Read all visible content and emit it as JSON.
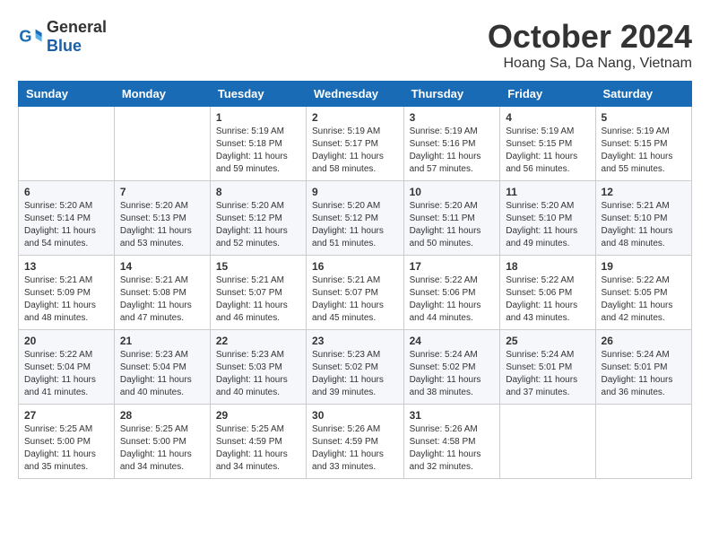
{
  "logo": {
    "general": "General",
    "blue": "Blue"
  },
  "title": "October 2024",
  "location": "Hoang Sa, Da Nang, Vietnam",
  "weekdays": [
    "Sunday",
    "Monday",
    "Tuesday",
    "Wednesday",
    "Thursday",
    "Friday",
    "Saturday"
  ],
  "weeks": [
    [
      {
        "day": "",
        "info": ""
      },
      {
        "day": "",
        "info": ""
      },
      {
        "day": "1",
        "sunrise": "Sunrise: 5:19 AM",
        "sunset": "Sunset: 5:18 PM",
        "daylight": "Daylight: 11 hours and 59 minutes."
      },
      {
        "day": "2",
        "sunrise": "Sunrise: 5:19 AM",
        "sunset": "Sunset: 5:17 PM",
        "daylight": "Daylight: 11 hours and 58 minutes."
      },
      {
        "day": "3",
        "sunrise": "Sunrise: 5:19 AM",
        "sunset": "Sunset: 5:16 PM",
        "daylight": "Daylight: 11 hours and 57 minutes."
      },
      {
        "day": "4",
        "sunrise": "Sunrise: 5:19 AM",
        "sunset": "Sunset: 5:15 PM",
        "daylight": "Daylight: 11 hours and 56 minutes."
      },
      {
        "day": "5",
        "sunrise": "Sunrise: 5:19 AM",
        "sunset": "Sunset: 5:15 PM",
        "daylight": "Daylight: 11 hours and 55 minutes."
      }
    ],
    [
      {
        "day": "6",
        "sunrise": "Sunrise: 5:20 AM",
        "sunset": "Sunset: 5:14 PM",
        "daylight": "Daylight: 11 hours and 54 minutes."
      },
      {
        "day": "7",
        "sunrise": "Sunrise: 5:20 AM",
        "sunset": "Sunset: 5:13 PM",
        "daylight": "Daylight: 11 hours and 53 minutes."
      },
      {
        "day": "8",
        "sunrise": "Sunrise: 5:20 AM",
        "sunset": "Sunset: 5:12 PM",
        "daylight": "Daylight: 11 hours and 52 minutes."
      },
      {
        "day": "9",
        "sunrise": "Sunrise: 5:20 AM",
        "sunset": "Sunset: 5:12 PM",
        "daylight": "Daylight: 11 hours and 51 minutes."
      },
      {
        "day": "10",
        "sunrise": "Sunrise: 5:20 AM",
        "sunset": "Sunset: 5:11 PM",
        "daylight": "Daylight: 11 hours and 50 minutes."
      },
      {
        "day": "11",
        "sunrise": "Sunrise: 5:20 AM",
        "sunset": "Sunset: 5:10 PM",
        "daylight": "Daylight: 11 hours and 49 minutes."
      },
      {
        "day": "12",
        "sunrise": "Sunrise: 5:21 AM",
        "sunset": "Sunset: 5:10 PM",
        "daylight": "Daylight: 11 hours and 48 minutes."
      }
    ],
    [
      {
        "day": "13",
        "sunrise": "Sunrise: 5:21 AM",
        "sunset": "Sunset: 5:09 PM",
        "daylight": "Daylight: 11 hours and 48 minutes."
      },
      {
        "day": "14",
        "sunrise": "Sunrise: 5:21 AM",
        "sunset": "Sunset: 5:08 PM",
        "daylight": "Daylight: 11 hours and 47 minutes."
      },
      {
        "day": "15",
        "sunrise": "Sunrise: 5:21 AM",
        "sunset": "Sunset: 5:07 PM",
        "daylight": "Daylight: 11 hours and 46 minutes."
      },
      {
        "day": "16",
        "sunrise": "Sunrise: 5:21 AM",
        "sunset": "Sunset: 5:07 PM",
        "daylight": "Daylight: 11 hours and 45 minutes."
      },
      {
        "day": "17",
        "sunrise": "Sunrise: 5:22 AM",
        "sunset": "Sunset: 5:06 PM",
        "daylight": "Daylight: 11 hours and 44 minutes."
      },
      {
        "day": "18",
        "sunrise": "Sunrise: 5:22 AM",
        "sunset": "Sunset: 5:06 PM",
        "daylight": "Daylight: 11 hours and 43 minutes."
      },
      {
        "day": "19",
        "sunrise": "Sunrise: 5:22 AM",
        "sunset": "Sunset: 5:05 PM",
        "daylight": "Daylight: 11 hours and 42 minutes."
      }
    ],
    [
      {
        "day": "20",
        "sunrise": "Sunrise: 5:22 AM",
        "sunset": "Sunset: 5:04 PM",
        "daylight": "Daylight: 11 hours and 41 minutes."
      },
      {
        "day": "21",
        "sunrise": "Sunrise: 5:23 AM",
        "sunset": "Sunset: 5:04 PM",
        "daylight": "Daylight: 11 hours and 40 minutes."
      },
      {
        "day": "22",
        "sunrise": "Sunrise: 5:23 AM",
        "sunset": "Sunset: 5:03 PM",
        "daylight": "Daylight: 11 hours and 40 minutes."
      },
      {
        "day": "23",
        "sunrise": "Sunrise: 5:23 AM",
        "sunset": "Sunset: 5:02 PM",
        "daylight": "Daylight: 11 hours and 39 minutes."
      },
      {
        "day": "24",
        "sunrise": "Sunrise: 5:24 AM",
        "sunset": "Sunset: 5:02 PM",
        "daylight": "Daylight: 11 hours and 38 minutes."
      },
      {
        "day": "25",
        "sunrise": "Sunrise: 5:24 AM",
        "sunset": "Sunset: 5:01 PM",
        "daylight": "Daylight: 11 hours and 37 minutes."
      },
      {
        "day": "26",
        "sunrise": "Sunrise: 5:24 AM",
        "sunset": "Sunset: 5:01 PM",
        "daylight": "Daylight: 11 hours and 36 minutes."
      }
    ],
    [
      {
        "day": "27",
        "sunrise": "Sunrise: 5:25 AM",
        "sunset": "Sunset: 5:00 PM",
        "daylight": "Daylight: 11 hours and 35 minutes."
      },
      {
        "day": "28",
        "sunrise": "Sunrise: 5:25 AM",
        "sunset": "Sunset: 5:00 PM",
        "daylight": "Daylight: 11 hours and 34 minutes."
      },
      {
        "day": "29",
        "sunrise": "Sunrise: 5:25 AM",
        "sunset": "Sunset: 4:59 PM",
        "daylight": "Daylight: 11 hours and 34 minutes."
      },
      {
        "day": "30",
        "sunrise": "Sunrise: 5:26 AM",
        "sunset": "Sunset: 4:59 PM",
        "daylight": "Daylight: 11 hours and 33 minutes."
      },
      {
        "day": "31",
        "sunrise": "Sunrise: 5:26 AM",
        "sunset": "Sunset: 4:58 PM",
        "daylight": "Daylight: 11 hours and 32 minutes."
      },
      {
        "day": "",
        "info": ""
      },
      {
        "day": "",
        "info": ""
      }
    ]
  ]
}
